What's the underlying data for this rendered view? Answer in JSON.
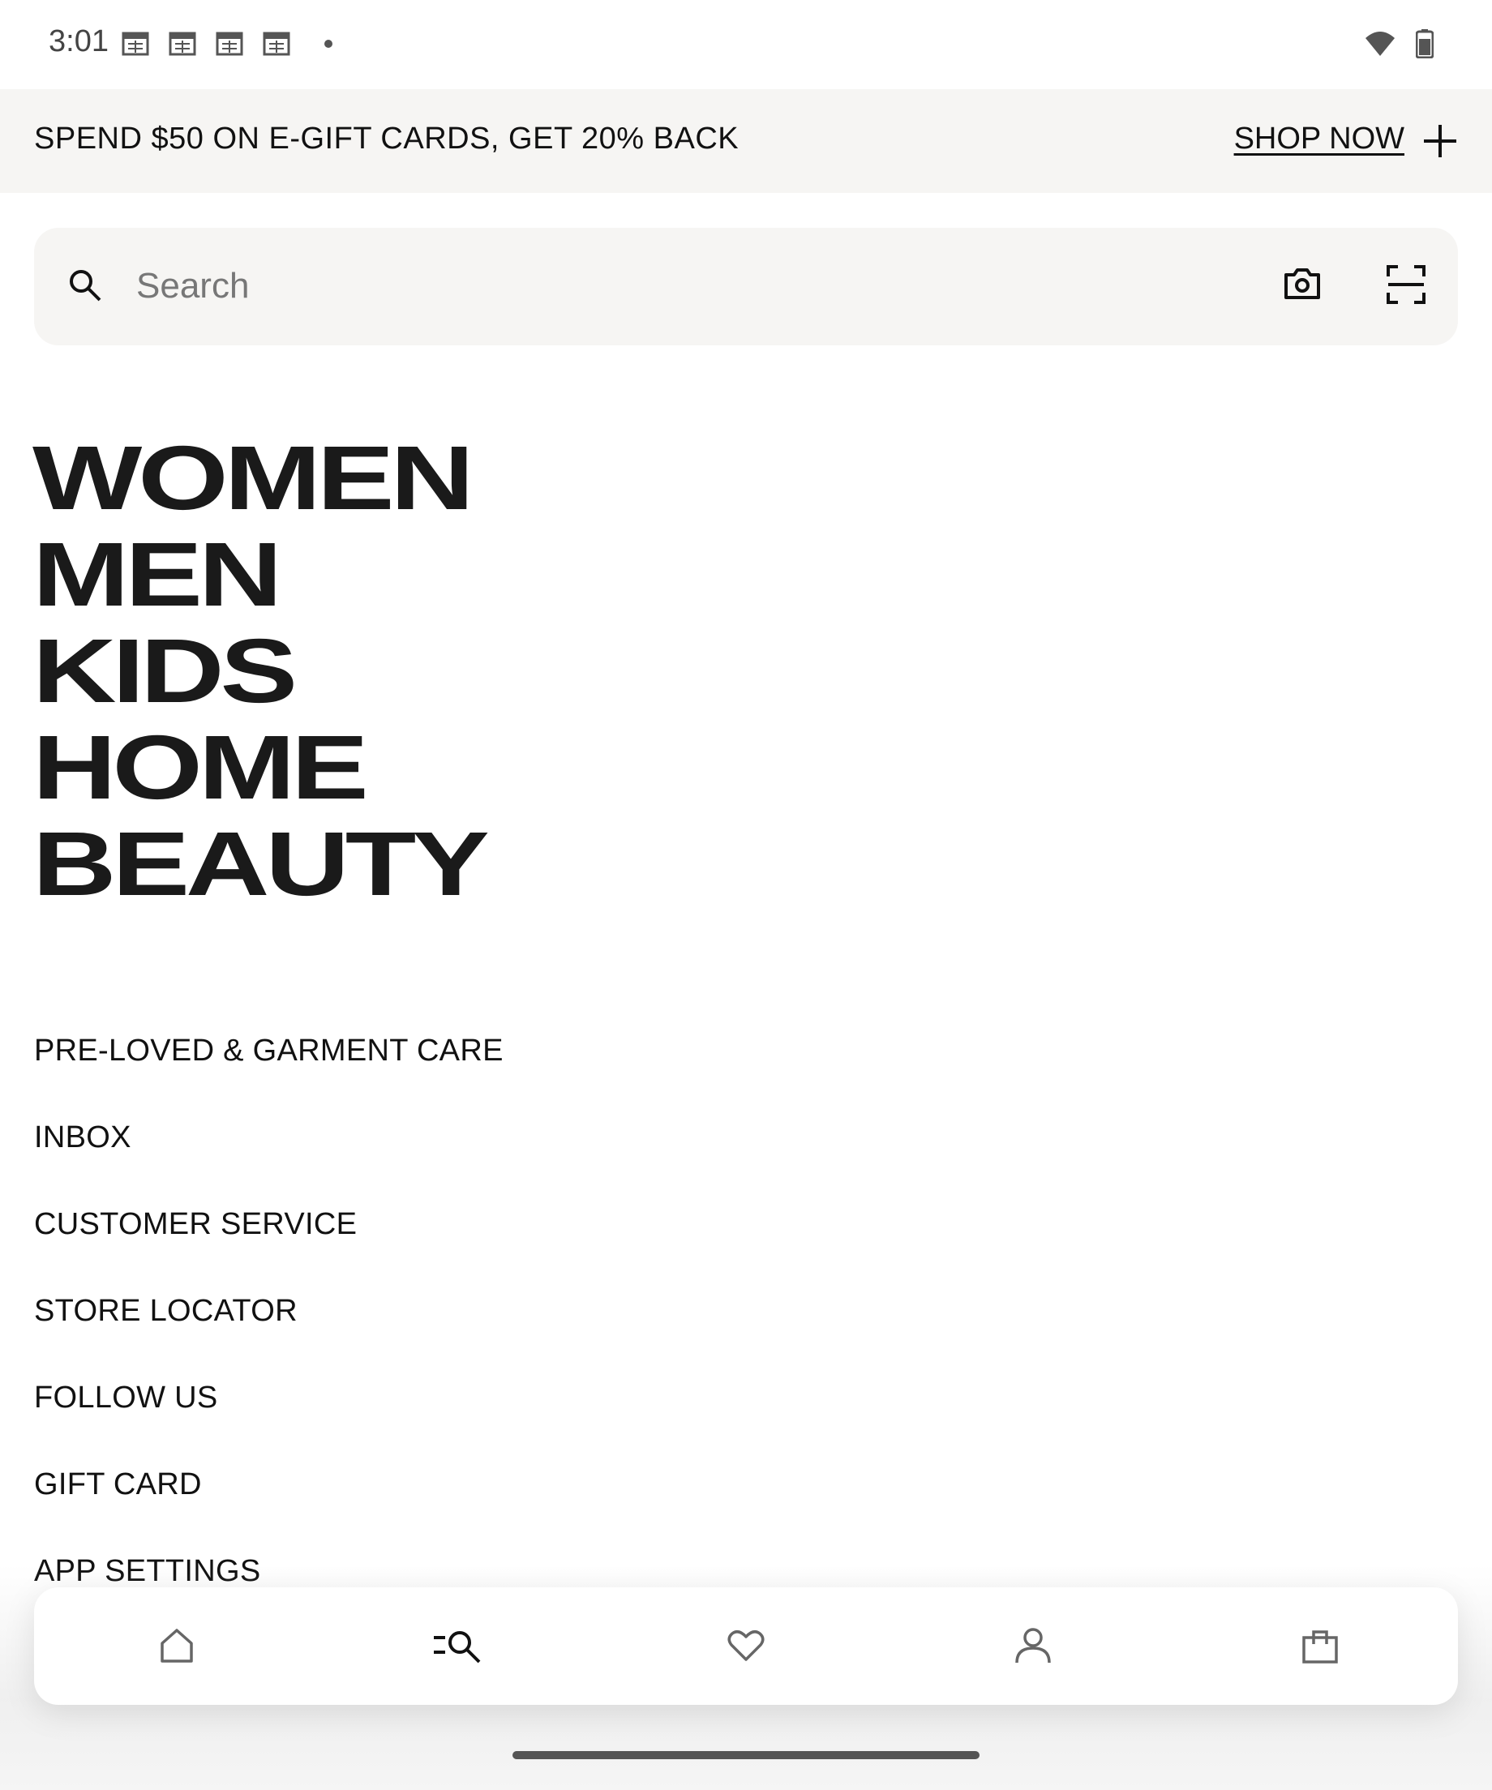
{
  "status_bar": {
    "time": "3:01",
    "left_icons": [
      "calendar-icon",
      "calendar-icon",
      "calendar-icon",
      "calendar-icon",
      "dot-icon"
    ],
    "right_icons": [
      "wifi-icon",
      "battery-icon"
    ]
  },
  "promo": {
    "text": "SPEND $50 ON E-GIFT CARDS, GET 20% BACK",
    "link_label": "SHOP NOW",
    "expand_icon": "plus-icon"
  },
  "search": {
    "placeholder": "Search",
    "value": "",
    "icons": [
      "search-icon",
      "camera-icon",
      "scan-icon"
    ]
  },
  "categories": [
    "WOMEN",
    "MEN",
    "KIDS",
    "HOME",
    "BEAUTY"
  ],
  "menu": [
    "PRE-LOVED & GARMENT CARE",
    "INBOX",
    "CUSTOMER SERVICE",
    "STORE LOCATOR",
    "FOLLOW US",
    "GIFT CARD",
    "APP SETTINGS"
  ],
  "bottom_nav": {
    "items": [
      "home-icon",
      "menu-search-icon",
      "heart-icon",
      "account-icon",
      "bag-icon"
    ],
    "active": "menu-search-icon"
  },
  "colors": {
    "banner_bg": "#f6f5f3",
    "text": "#111111",
    "category_text": "#1a1a1a",
    "icon_grey": "#555555"
  }
}
